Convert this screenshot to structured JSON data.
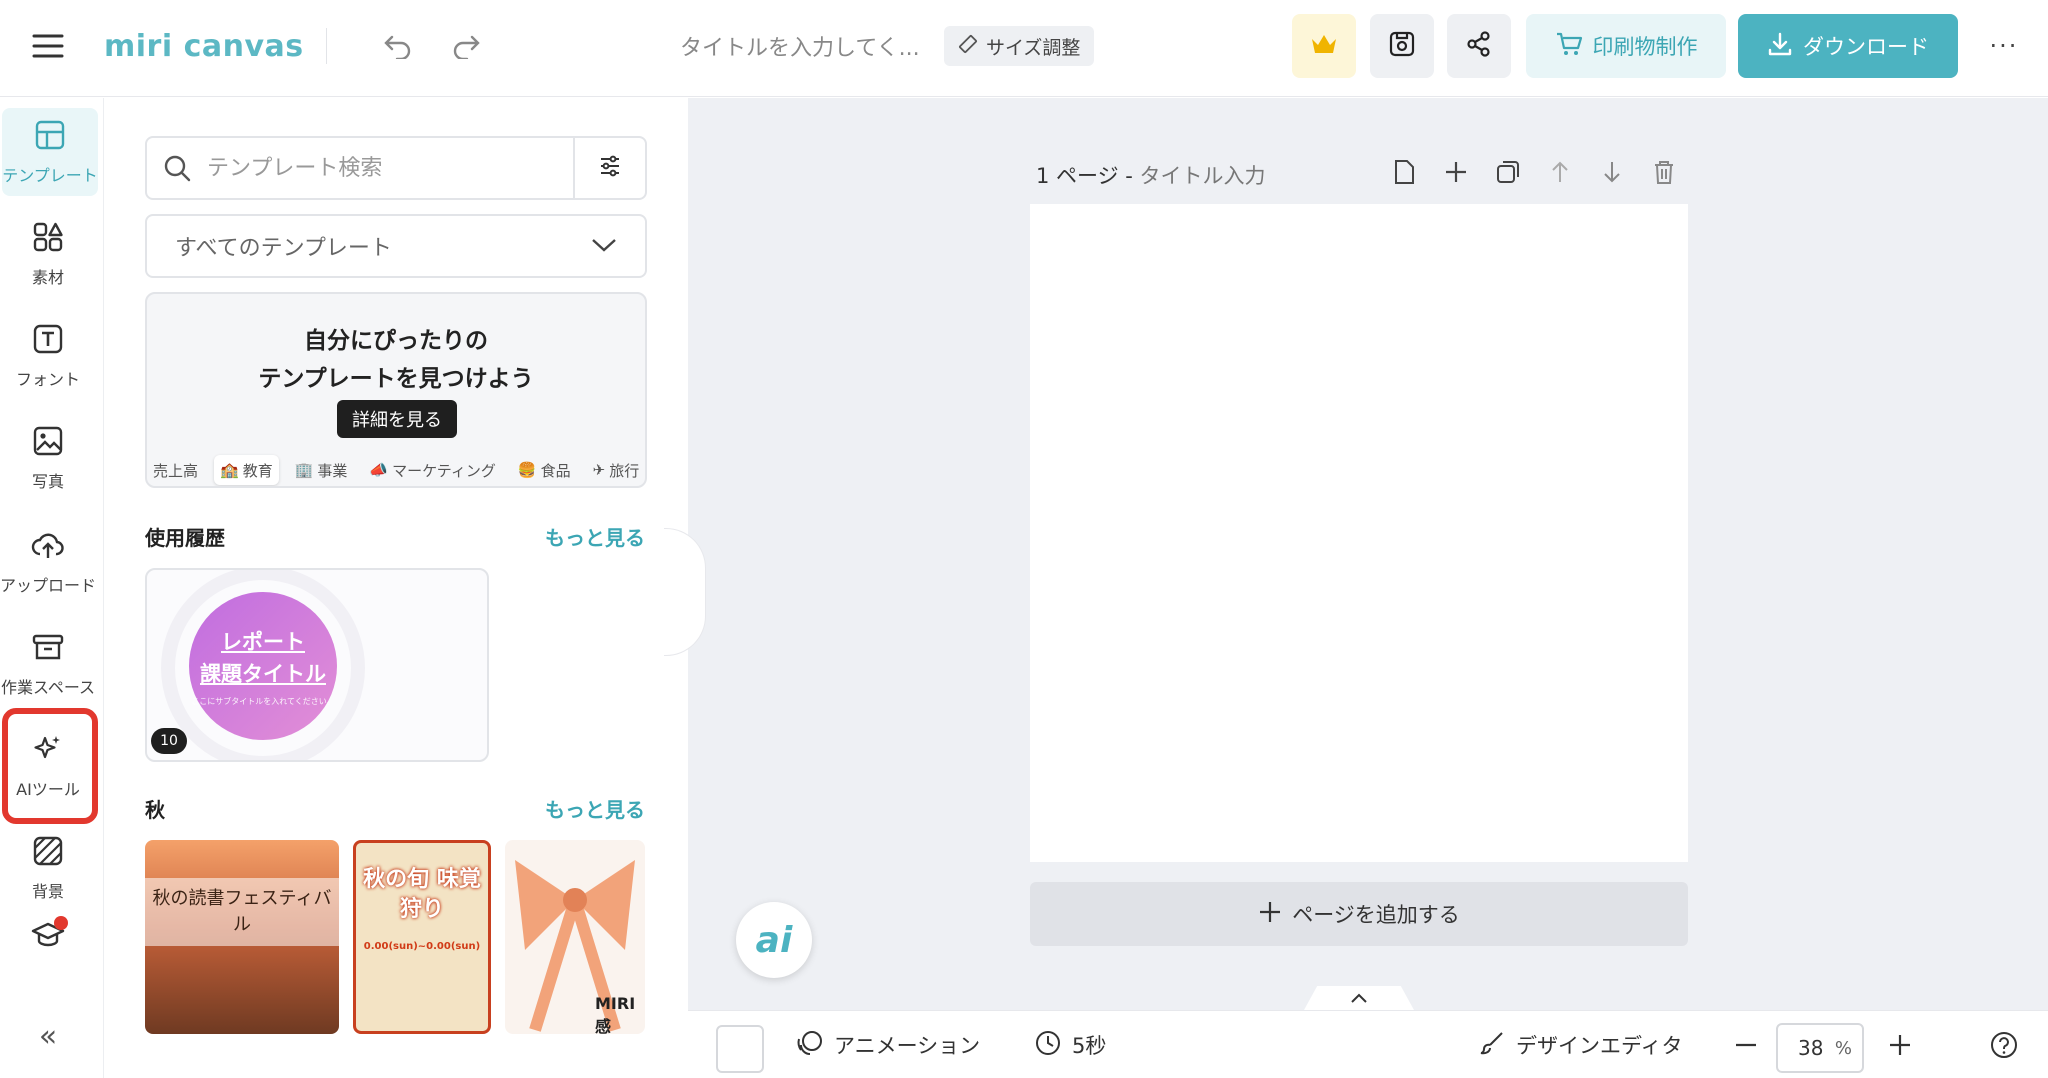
{
  "app": {
    "logo_text": "miri canvas",
    "doc_title": "タイトルを入力してく...",
    "size_button": "サイズ調整",
    "print_button": "印刷物制作",
    "download_button": "ダウンロード",
    "more_label": "···"
  },
  "rail": {
    "items": [
      {
        "label": "テンプレート",
        "icon": "template-icon"
      },
      {
        "label": "素材",
        "icon": "elements-icon"
      },
      {
        "label": "フォント",
        "icon": "font-icon"
      },
      {
        "label": "写真",
        "icon": "photo-icon"
      },
      {
        "label": "アップロード",
        "icon": "upload-icon"
      },
      {
        "label": "作業スペース",
        "icon": "workspace-icon"
      },
      {
        "label": "AIツール",
        "icon": "ai-tools-icon"
      },
      {
        "label": "背景",
        "icon": "background-icon"
      }
    ],
    "collapse_label": "«"
  },
  "panel": {
    "search_placeholder": "テンプレート検索",
    "select_value": "すべてのテンプレート",
    "banner_line1": "自分にぴったりの",
    "banner_line2": "テンプレートを見つけよう",
    "banner_button": "詳細を見る",
    "chips": [
      "売上高",
      "教育",
      "事業",
      "マーケティング",
      "食品",
      "旅行"
    ],
    "history_title": "使用履歴",
    "more_link": "もっと見る",
    "history_card": {
      "line1": "レポート",
      "line2": "課題タイトル",
      "line3": "ここにサブタイトルを入れてください。",
      "badge": "10"
    },
    "section2_title": "秋",
    "autumn_cards": [
      {
        "text": "秋の読書フェスティバル"
      },
      {
        "text": "秋の旬 味覚狩り",
        "sub": "0.00(sun)~0.00(sun)"
      },
      {
        "text": "MIRI感"
      }
    ]
  },
  "canvas": {
    "page_label": "1 ページ - ",
    "page_title": "タイトル入力",
    "add_page": "ページを追加する",
    "ai_fab": "ai"
  },
  "bottombar": {
    "animation": "アニメーション",
    "duration": "5秒",
    "design_editor": "デザインエディタ",
    "zoom_value": "38",
    "zoom_unit": "%"
  },
  "colors": {
    "accent": "#4cb3c1",
    "highlight": "#e2382e"
  }
}
